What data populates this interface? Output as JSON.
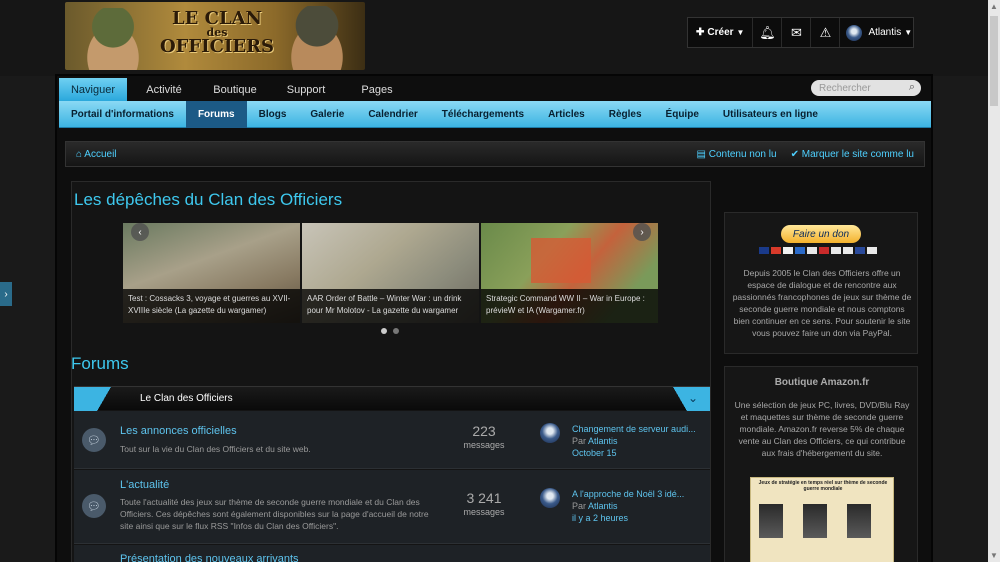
{
  "header": {
    "logo_alt": "Le Clan des Officiers",
    "logo_line1": "LE CLAN",
    "logo_line2": "des",
    "logo_line3": "OFFICIERS"
  },
  "userbar": {
    "create_label": "Créer",
    "create_icon": "plus-icon",
    "icons": [
      "bell-icon",
      "envelope-icon",
      "warning-icon"
    ],
    "user_name": "Atlantis"
  },
  "nav": {
    "tabs": [
      {
        "label": "Naviguer",
        "active": true
      },
      {
        "label": "Activité",
        "active": false
      },
      {
        "label": "Boutique",
        "active": false
      },
      {
        "label": "Support",
        "active": false
      },
      {
        "label": "Pages",
        "active": false
      }
    ],
    "search_placeholder": "Rechercher",
    "sub_items": [
      {
        "label": "Portail d'informations",
        "active": false
      },
      {
        "label": "Forums",
        "active": true
      },
      {
        "label": "Blogs",
        "active": false
      },
      {
        "label": "Galerie",
        "active": false
      },
      {
        "label": "Calendrier",
        "active": false
      },
      {
        "label": "Téléchargements",
        "active": false
      },
      {
        "label": "Articles",
        "active": false
      },
      {
        "label": "Règles",
        "active": false
      },
      {
        "label": "Équipe",
        "active": false
      },
      {
        "label": "Utilisateurs en ligne",
        "active": false
      }
    ]
  },
  "breadcrumb": {
    "home": "Accueil",
    "unread": "Contenu non lu",
    "mark_read": "Marquer le site comme lu"
  },
  "news": {
    "title": "Les dépêches du Clan des Officiers",
    "slides": [
      {
        "caption": "Test : Cossacks 3, voyage et guerres au XVII-XVIIIe siècle (La gazette du wargamer)"
      },
      {
        "caption": "AAR Order of Battle – Winter War : un drink pour Mr Molotov - La gazette du wargamer"
      },
      {
        "caption": "Strategic Command WW II – War in Europe : prévieW et IA (Wargamer.fr)"
      }
    ]
  },
  "forums": {
    "title": "Forums",
    "category": "Le Clan des Officiers",
    "rows": [
      {
        "name": "Les annonces officielles",
        "desc": "Tout sur la vie du Clan des Officiers et du site web.",
        "count": "223",
        "count_label": "messages",
        "last_title": "Changement de serveur audi...",
        "last_by_prefix": "Par",
        "last_by": "Atlantis",
        "last_date": "October 15"
      },
      {
        "name": "L'actualité",
        "desc": "Toute l'actualité des jeux sur thème de seconde guerre mondiale et du Clan des Officiers. Ces dépêches sont également disponibles sur la page d'accueil de notre site ainsi que sur le flux RSS \"Infos du Clan des Officiers\".",
        "count": "3 241",
        "count_label": "messages",
        "last_title": "A l'approche de Noël 3 idé...",
        "last_by_prefix": "Par",
        "last_by": "Atlantis",
        "last_date": "il y a 2 heures"
      },
      {
        "name": "Présentation des nouveaux arrivants"
      }
    ]
  },
  "sidebar": {
    "paypal_label": "Faire un don",
    "paypal_text": "Depuis 2005 le Clan des Officiers offre un espace de dialogue et de rencontre aux passionnés francophones de jeux sur thème de seconde guerre mondiale et nous comptons bien continuer en ce sens. Pour soutenir le site vous pouvez faire un don via PayPal.",
    "amazon_title": "Boutique Amazon.fr",
    "amazon_text": "Une sélection de jeux PC, livres, DVD/Blu Ray et maquettes sur thème de seconde guerre mondiale. Amazon.fr reverse 5% de chaque vente au Clan des Officiers, ce qui contribue aux frais d'hébergement du site.",
    "amazon_banner_head": "Jeux de stratégie en temps réel sur thème de seconde guerre mondiale"
  },
  "colors": {
    "accent": "#3cb4e2",
    "link": "#5ec4ee",
    "background": "#1a1a1a"
  }
}
